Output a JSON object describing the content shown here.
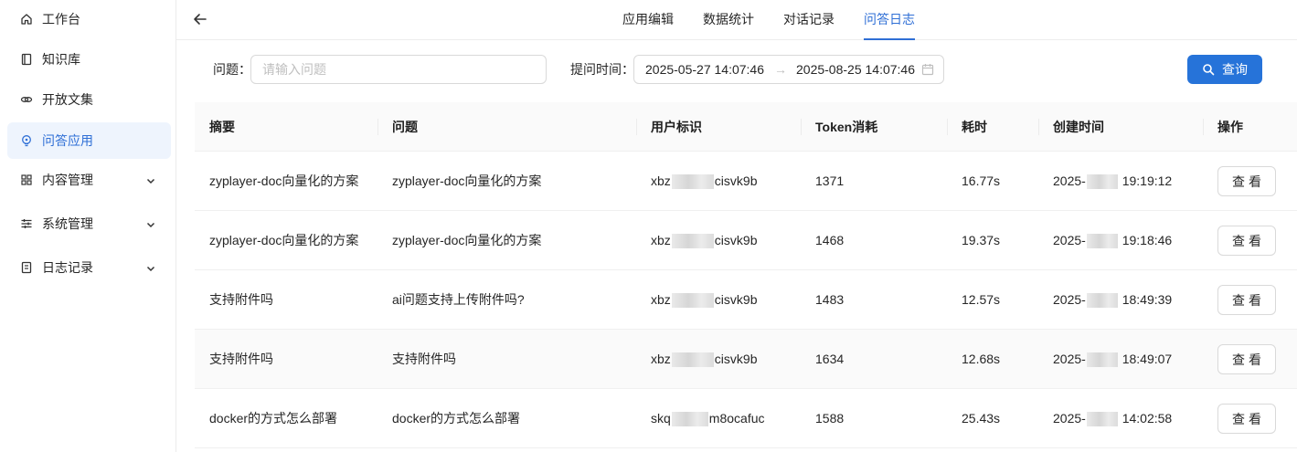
{
  "sidebar": {
    "items": [
      {
        "label": "工作台",
        "icon": "home-icon"
      },
      {
        "label": "知识库",
        "icon": "book-icon"
      },
      {
        "label": "开放文集",
        "icon": "link-icon"
      },
      {
        "label": "问答应用",
        "icon": "bulb-icon",
        "active": true
      },
      {
        "label": "内容管理",
        "icon": "grid-icon",
        "expandable": true
      },
      {
        "label": "系统管理",
        "icon": "sliders-icon",
        "expandable": true
      },
      {
        "label": "日志记录",
        "icon": "file-icon",
        "expandable": true
      }
    ]
  },
  "tabs": [
    {
      "label": "应用编辑"
    },
    {
      "label": "数据统计"
    },
    {
      "label": "对话记录"
    },
    {
      "label": "问答日志",
      "active": true
    }
  ],
  "filters": {
    "question_label": "问题：",
    "question_placeholder": "请输入问题",
    "time_label": "提问时间：",
    "start_time": "2025-05-27 14:07:46",
    "end_time": "2025-08-25 14:07:46",
    "arrow": "→",
    "search_button": "查询"
  },
  "table": {
    "columns": [
      "摘要",
      "问题",
      "用户标识",
      "Token消耗",
      "耗时",
      "创建时间",
      "操作"
    ],
    "rows": [
      {
        "summary": "zyplayer-doc向量化的方案",
        "question": "zyplayer-doc向量化的方案",
        "user_prefix": "xbz",
        "user_suffix": "cisvk9b",
        "tokens": "1371",
        "duration": "16.77s",
        "created_prefix": "2025-",
        "created_suffix": "19:19:12",
        "action": "查看"
      },
      {
        "summary": "zyplayer-doc向量化的方案",
        "question": "zyplayer-doc向量化的方案",
        "user_prefix": "xbz",
        "user_suffix": "cisvk9b",
        "tokens": "1468",
        "duration": "19.37s",
        "created_prefix": "2025-",
        "created_suffix": "19:18:46",
        "action": "查看"
      },
      {
        "summary": "支持附件吗",
        "question": "ai问题支持上传附件吗?",
        "user_prefix": "xbz",
        "user_suffix": "cisvk9b",
        "tokens": "1483",
        "duration": "12.57s",
        "created_prefix": "2025-",
        "created_suffix": "18:49:39",
        "action": "查看"
      },
      {
        "summary": "支持附件吗",
        "question": "支持附件吗",
        "user_prefix": "xbz",
        "user_suffix": "cisvk9b",
        "tokens": "1634",
        "duration": "12.68s",
        "created_prefix": "2025-",
        "created_suffix": "18:49:07",
        "action": "查看"
      },
      {
        "summary": "docker的方式怎么部署",
        "question": "docker的方式怎么部署",
        "user_prefix": "skq",
        "user_suffix": "m8ocafuc",
        "tokens": "1588",
        "duration": "25.43s",
        "created_prefix": "2025-",
        "created_suffix": "14:02:58",
        "action": "查看"
      }
    ]
  },
  "colors": {
    "accent": "#2673d9",
    "active_bg": "#eef4fd",
    "active_text": "#2f6fd6"
  }
}
